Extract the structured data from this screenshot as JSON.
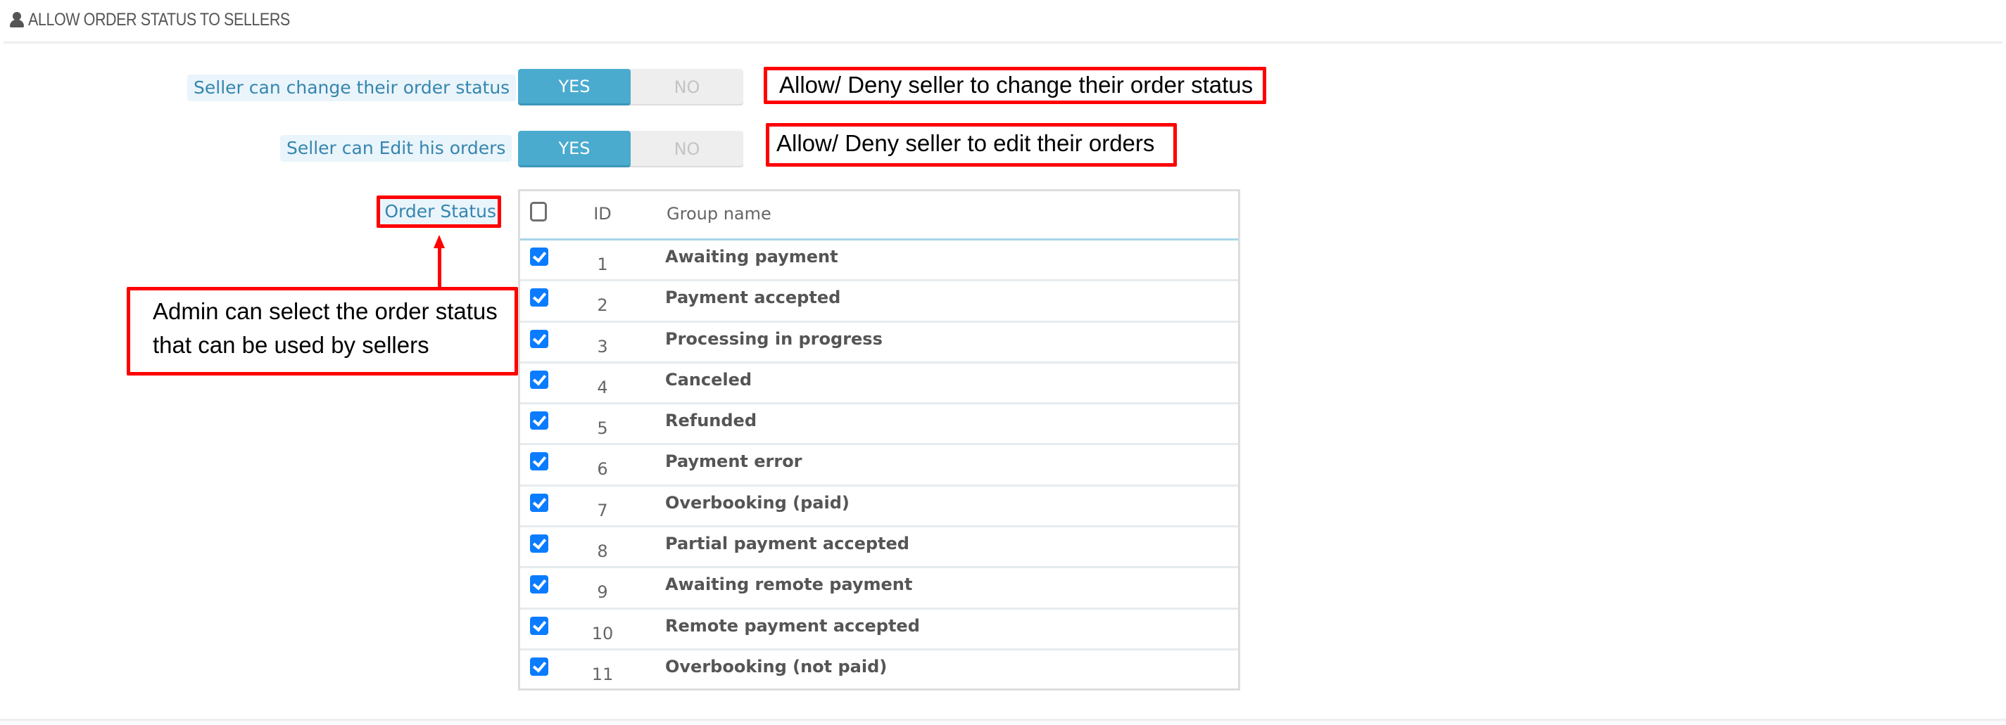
{
  "panel": {
    "icon": "user-icon",
    "title": "ALLOW ORDER STATUS TO SELLERS"
  },
  "settings": [
    {
      "label": "Seller can change their order status",
      "options": [
        "YES",
        "NO"
      ],
      "selected": "YES",
      "callout": "Allow/ Deny seller to change their order status"
    },
    {
      "label": "Seller can Edit his orders",
      "options": [
        "YES",
        "NO"
      ],
      "selected": "YES",
      "callout": "Allow/ Deny seller to edit their orders"
    }
  ],
  "order_status": {
    "label": "Order Status",
    "callout_line1": "Admin can select the order status",
    "callout_line2": "that can be used by sellers",
    "select_all_checked": false,
    "columns": {
      "id": "ID",
      "name": "Group name"
    },
    "rows": [
      {
        "id": "1",
        "name": "Awaiting payment",
        "checked": true
      },
      {
        "id": "2",
        "name": "Payment accepted",
        "checked": true
      },
      {
        "id": "3",
        "name": "Processing in progress",
        "checked": true
      },
      {
        "id": "4",
        "name": "Canceled",
        "checked": true
      },
      {
        "id": "5",
        "name": "Refunded",
        "checked": true
      },
      {
        "id": "6",
        "name": "Payment error",
        "checked": true
      },
      {
        "id": "7",
        "name": "Overbooking (paid)",
        "checked": true
      },
      {
        "id": "8",
        "name": "Partial payment accepted",
        "checked": true
      },
      {
        "id": "9",
        "name": "Awaiting remote payment",
        "checked": true
      },
      {
        "id": "10",
        "name": "Remote payment accepted",
        "checked": true
      },
      {
        "id": "11",
        "name": "Overbooking (not paid)",
        "checked": true
      }
    ]
  },
  "colors": {
    "toggle_active": "#4aabcf",
    "label_text": "#3586ae",
    "label_bg": "#eaf4fb",
    "checkbox": "#0b7cff",
    "annotation": "#ff0000"
  }
}
